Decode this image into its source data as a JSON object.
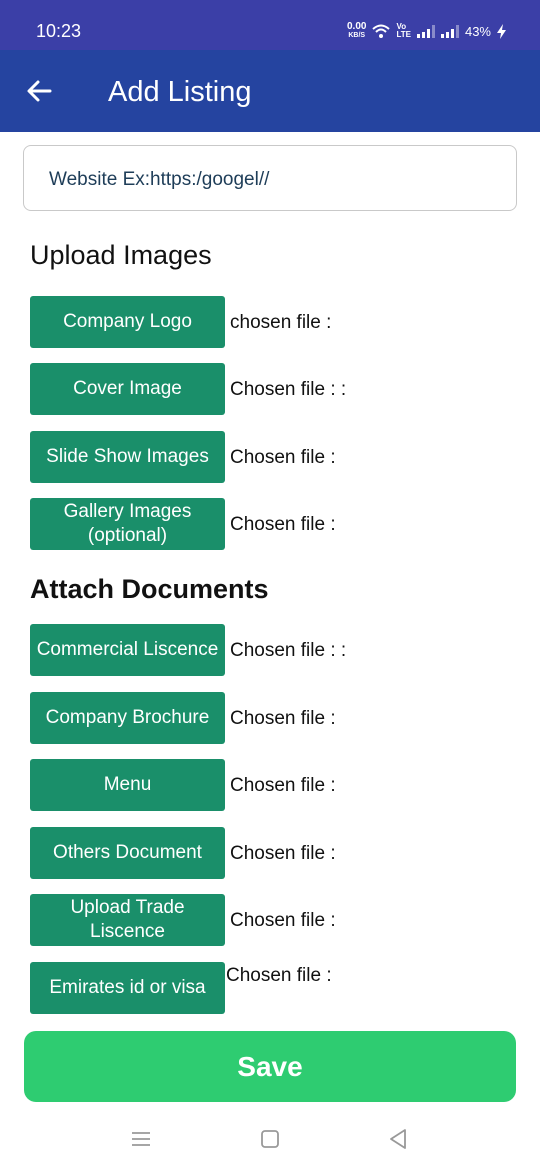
{
  "status_bar": {
    "time": "10:23",
    "net_speed_value": "0.00",
    "net_speed_unit": "KB/S",
    "volte_top": "Vo",
    "volte_bottom": "LTE",
    "battery": "43%"
  },
  "app_bar": {
    "title": "Add Listing",
    "back_icon": "arrow-left-icon"
  },
  "website_field": {
    "placeholder": "Website Ex:https:/googel//"
  },
  "upload_images": {
    "title": "Upload Images",
    "items": [
      {
        "button": "Company Logo",
        "chosen": "chosen file :"
      },
      {
        "button": "Cover Image",
        "chosen": "Chosen file : :"
      },
      {
        "button": "Slide Show Images",
        "chosen": "Chosen file :"
      },
      {
        "button": "Gallery Images (optional)",
        "chosen": "Chosen file :"
      }
    ]
  },
  "attach_documents": {
    "title": "Attach Documents",
    "items": [
      {
        "button": "Commercial Liscence",
        "chosen": "Chosen file : :"
      },
      {
        "button": "Company Brochure",
        "chosen": "Chosen file :"
      },
      {
        "button": "Menu",
        "chosen": "Chosen file :"
      },
      {
        "button": "Others Document",
        "chosen": "Chosen file :"
      },
      {
        "button": "Upload Trade Liscence",
        "chosen": "Chosen file :"
      },
      {
        "button": "Emirates id or visa",
        "chosen": "Chosen file :"
      }
    ]
  },
  "save_button": "Save",
  "colors": {
    "status_bar": "#3b3fa7",
    "app_bar": "#2544a0",
    "upload_button": "#1a8f6a",
    "save_button": "#2ecc71"
  },
  "nav_icons": [
    "menu-icon",
    "home-square-icon",
    "back-triangle-icon"
  ]
}
